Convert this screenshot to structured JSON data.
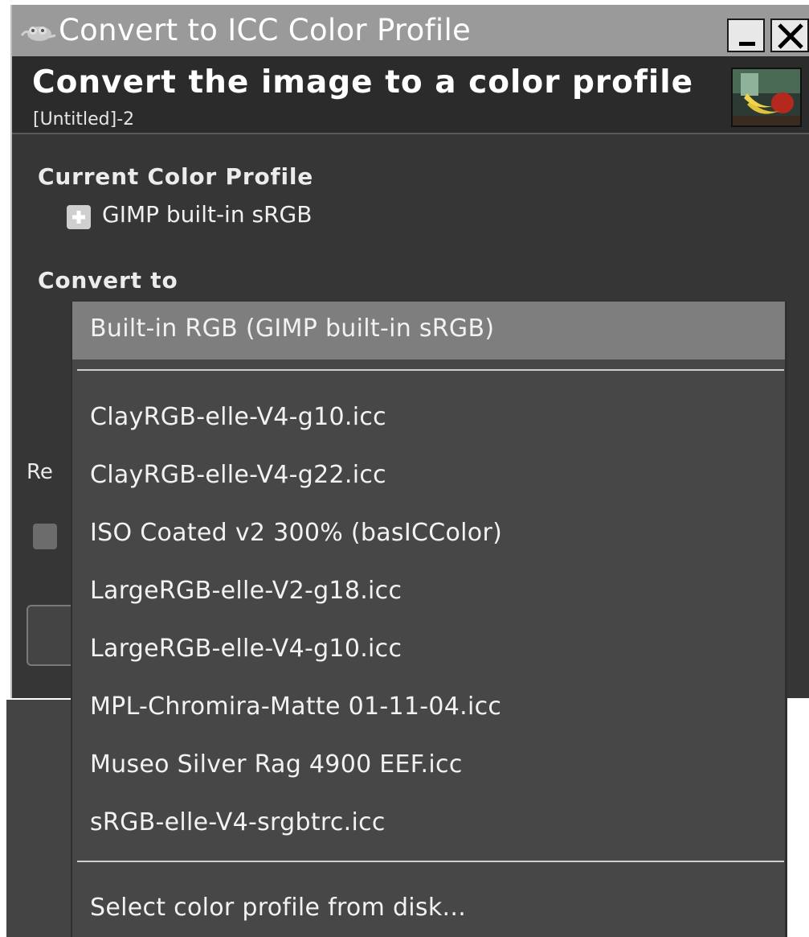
{
  "window": {
    "title": "Convert to ICC Color Profile",
    "minimize_label": "_",
    "close_label": "X"
  },
  "header": {
    "title": "Convert the image to a color profile",
    "subtitle": "[Untitled]-2"
  },
  "current_profile": {
    "section_label": "Current Color Profile",
    "profile_name": "GIMP built-in sRGB"
  },
  "convert_to": {
    "section_label": "Convert to"
  },
  "background": {
    "partial_text": "Re"
  },
  "dropdown": {
    "selected_item": "Built-in RGB (GIMP built-in sRGB)",
    "items": [
      "ClayRGB-elle-V4-g10.icc",
      "ClayRGB-elle-V4-g22.icc",
      "ISO Coated v2 300% (basICColor)",
      "LargeRGB-elle-V2-g18.icc",
      "LargeRGB-elle-V4-g10.icc",
      "MPL-Chromira-Matte 01-11-04.icc",
      "Museo Silver Rag 4900 EEF.icc",
      "sRGB-elle-V4-srgbtrc.icc"
    ],
    "footer_item": "Select color profile from disk..."
  },
  "colors": {
    "window_bg": "#363636",
    "titlebar_bg": "#9a9a9a",
    "menu_bg": "#474747",
    "menu_selected_bg": "#7e7e7e"
  }
}
